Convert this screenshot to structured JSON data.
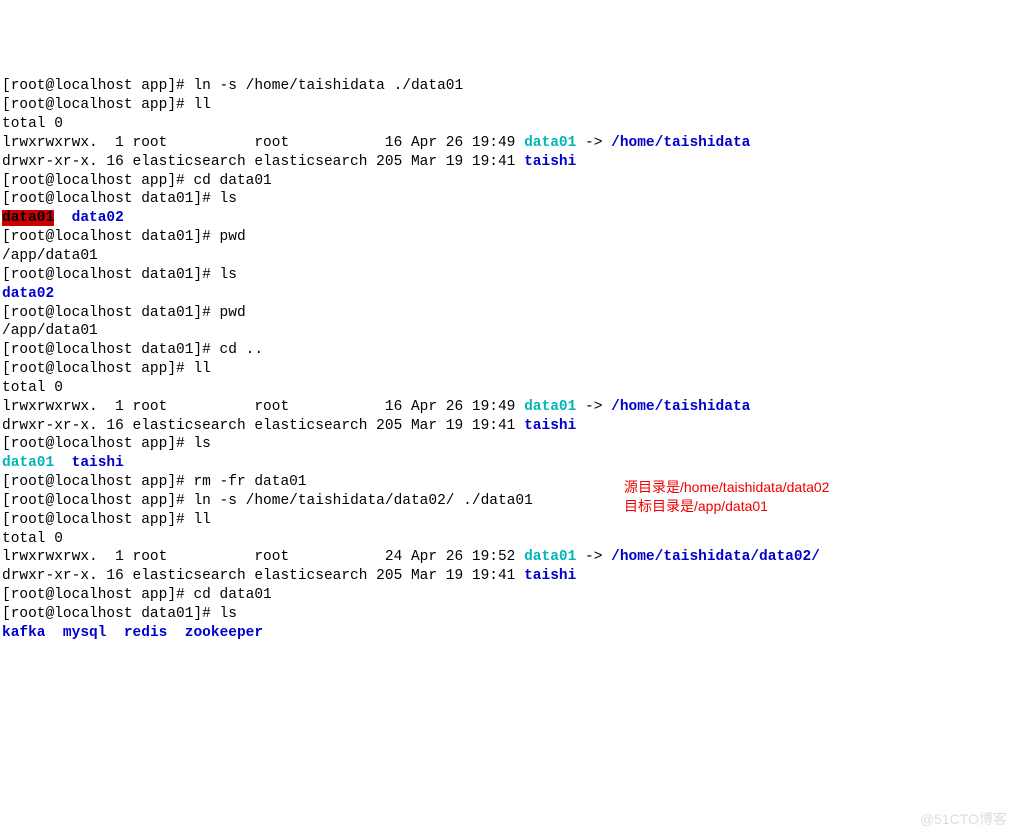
{
  "lines": [
    {
      "type": "prompt",
      "prompt": "[root@localhost app]# ",
      "cmd": "ln -s /home/taishidata ./data01"
    },
    {
      "type": "prompt",
      "prompt": "[root@localhost app]# ",
      "cmd": "ll"
    },
    {
      "type": "plain",
      "text": "total 0"
    },
    {
      "type": "listing",
      "perms": "lrwxrwxrwx.  1 root          root           16 Apr 26 19:49 ",
      "link": "data01",
      "arrow": " -> ",
      "target": "/home/taishidata"
    },
    {
      "type": "listing2",
      "perms": "drwxr-xr-x. 16 elasticsearch elasticsearch 205 Mar 19 19:41 ",
      "dir": "taishi"
    },
    {
      "type": "prompt",
      "prompt": "[root@localhost app]# ",
      "cmd": "cd data01"
    },
    {
      "type": "prompt",
      "prompt": "[root@localhost data01]# ",
      "cmd": "ls"
    },
    {
      "type": "ls-out1",
      "item1": "data01",
      "sep": "  ",
      "item2": "data02"
    },
    {
      "type": "prompt",
      "prompt": "[root@localhost data01]# ",
      "cmd": "pwd"
    },
    {
      "type": "plain",
      "text": "/app/data01"
    },
    {
      "type": "prompt",
      "prompt": "[root@localhost data01]# ",
      "cmd": "ls"
    },
    {
      "type": "ls-out2",
      "item": "data02"
    },
    {
      "type": "prompt",
      "prompt": "[root@localhost data01]# ",
      "cmd": "pwd"
    },
    {
      "type": "plain",
      "text": "/app/data01"
    },
    {
      "type": "prompt",
      "prompt": "[root@localhost data01]# ",
      "cmd": "cd .."
    },
    {
      "type": "prompt",
      "prompt": "[root@localhost app]# ",
      "cmd": "ll"
    },
    {
      "type": "plain",
      "text": "total 0"
    },
    {
      "type": "listing",
      "perms": "lrwxrwxrwx.  1 root          root           16 Apr 26 19:49 ",
      "link": "data01",
      "arrow": " -> ",
      "target": "/home/taishidata"
    },
    {
      "type": "listing2",
      "perms": "drwxr-xr-x. 16 elasticsearch elasticsearch 205 Mar 19 19:41 ",
      "dir": "taishi"
    },
    {
      "type": "prompt",
      "prompt": "[root@localhost app]# ",
      "cmd": "ls"
    },
    {
      "type": "ls-out3",
      "item1": "data01",
      "sep": "  ",
      "item2": "taishi"
    },
    {
      "type": "prompt",
      "prompt": "[root@localhost app]# ",
      "cmd": "rm -fr data01"
    },
    {
      "type": "prompt",
      "prompt": "[root@localhost app]# ",
      "cmd": "ln -s /home/taishidata/data02/ ./data01"
    },
    {
      "type": "prompt",
      "prompt": "[root@localhost app]# ",
      "cmd": "ll"
    },
    {
      "type": "plain",
      "text": "total 0"
    },
    {
      "type": "listing",
      "perms": "lrwxrwxrwx.  1 root          root           24 Apr 26 19:52 ",
      "link": "data01",
      "arrow": " -> ",
      "target": "/home/taishidata/data02/"
    },
    {
      "type": "listing2",
      "perms": "drwxr-xr-x. 16 elasticsearch elasticsearch 205 Mar 19 19:41 ",
      "dir": "taishi"
    },
    {
      "type": "prompt",
      "prompt": "[root@localhost app]# ",
      "cmd": "cd data01"
    },
    {
      "type": "prompt",
      "prompt": "[root@localhost data01]# ",
      "cmd": "ls"
    },
    {
      "type": "ls-out4",
      "items": [
        "kafka",
        "mysql",
        "redis",
        "zookeeper"
      ],
      "sep": "  "
    }
  ],
  "annotations": {
    "a1": "源目录是/home/taishidata/data02",
    "a2": "目标目录是/app/data01"
  },
  "watermark": "@51CTO博客"
}
